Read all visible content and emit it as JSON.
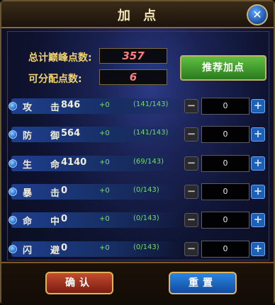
{
  "window": {
    "title": "加 点",
    "close_icon": "close-x"
  },
  "summary": {
    "total_label": "总计巅峰点数:",
    "total_value": "357",
    "available_label": "可分配点数:",
    "available_value": "6",
    "recommend_label": "推荐加点"
  },
  "stats": [
    {
      "name": "攻击",
      "value": "846",
      "bonus": "+0",
      "ratio": "(141/143)",
      "input": "0"
    },
    {
      "name": "防御",
      "value": "564",
      "bonus": "+0",
      "ratio": "(141/143)",
      "input": "0"
    },
    {
      "name": "生命",
      "value": "4140",
      "bonus": "+0",
      "ratio": "(69/143)",
      "input": "0"
    },
    {
      "name": "暴击",
      "value": "0",
      "bonus": "+0",
      "ratio": "(0/143)",
      "input": "0"
    },
    {
      "name": "命中",
      "value": "0",
      "bonus": "+0",
      "ratio": "(0/143)",
      "input": "0"
    },
    {
      "name": "闪避",
      "value": "0",
      "bonus": "+0",
      "ratio": "(0/143)",
      "input": "0"
    }
  ],
  "controls": {
    "minus": "−",
    "plus": "+"
  },
  "footer": {
    "confirm_label": "确认",
    "reset_label": "重置"
  },
  "colors": {
    "accent_gold": "#e0b45a",
    "stat_green": "#6fe05a",
    "value_red": "#ff7d7d"
  }
}
